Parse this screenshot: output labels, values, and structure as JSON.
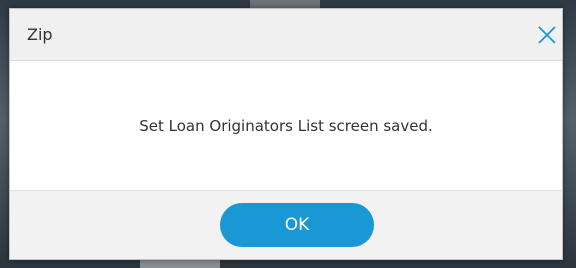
{
  "dialog": {
    "title": "Zip",
    "close_icon": "close-icon",
    "message": "Set Loan Originators List screen saved.",
    "ok_label": "OK"
  },
  "colors": {
    "accent": "#1a97d5",
    "close_icon": "#1a97d5",
    "text": "#333333"
  }
}
